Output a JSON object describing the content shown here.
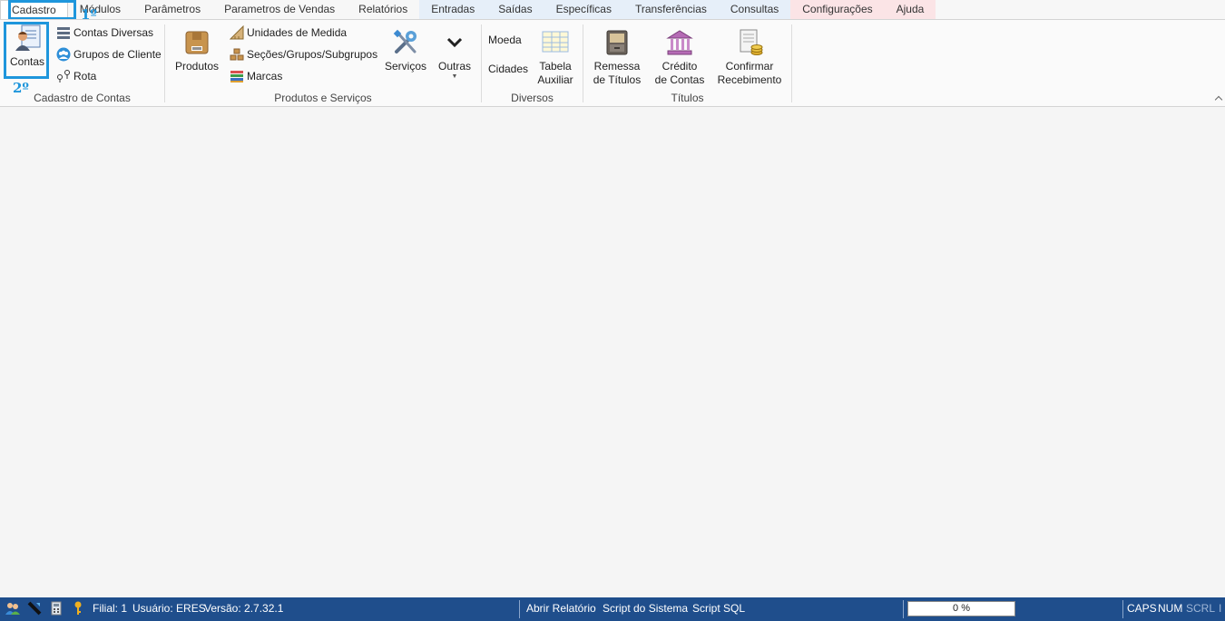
{
  "tabs": [
    {
      "label": "Cadastro"
    },
    {
      "label": "Módulos"
    },
    {
      "label": "Parâmetros"
    },
    {
      "label": "Parametros de Vendas"
    },
    {
      "label": "Relatórios"
    },
    {
      "label": "Entradas"
    },
    {
      "label": "Saídas"
    },
    {
      "label": "Específicas"
    },
    {
      "label": "Transferências"
    },
    {
      "label": "Consultas"
    },
    {
      "label": "Configurações"
    },
    {
      "label": "Ajuda"
    }
  ],
  "annotations": {
    "step1": "1º",
    "step2": "2º"
  },
  "ribbon": {
    "cadastro_contas": {
      "label": "Cadastro de Contas",
      "contas": "Contas",
      "contas_diversas": "Contas Diversas",
      "grupos_cliente": "Grupos de Cliente",
      "rota": "Rota"
    },
    "produtos_servicos": {
      "label": "Produtos e Serviços",
      "produtos": "Produtos",
      "unidades": "Unidades de Medida",
      "secoes": "Seções/Grupos/Subgrupos",
      "marcas": "Marcas",
      "servicos": "Serviços",
      "outras": "Outras"
    },
    "diversos": {
      "label": "Diversos",
      "moeda": "Moeda",
      "cidades": "Cidades",
      "tabela_l1": "Tabela",
      "tabela_l2": "Auxiliar"
    },
    "titulos": {
      "label": "Títulos",
      "remessa_l1": "Remessa",
      "remessa_l2": "de Títulos",
      "credito_l1": "Crédito",
      "credito_l2": "de Contas",
      "confirmar_l1": "Confirmar",
      "confirmar_l2": "Recebimento"
    }
  },
  "statusbar": {
    "filial": "Filial: 1",
    "usuario": "Usuário: ERES",
    "versao": "Versão: 2.7.32.1",
    "abrir_relatorio": "Abrir Relatório",
    "script_sistema": "Script do Sistema",
    "script_sql": "Script SQL",
    "progress": "0 %",
    "caps": "CAPS",
    "num": "NUM",
    "scrl": "SCRL",
    "ins": "I"
  },
  "colors": {
    "accent": "#1e96dc",
    "statusbar": "#1f4e8c"
  }
}
